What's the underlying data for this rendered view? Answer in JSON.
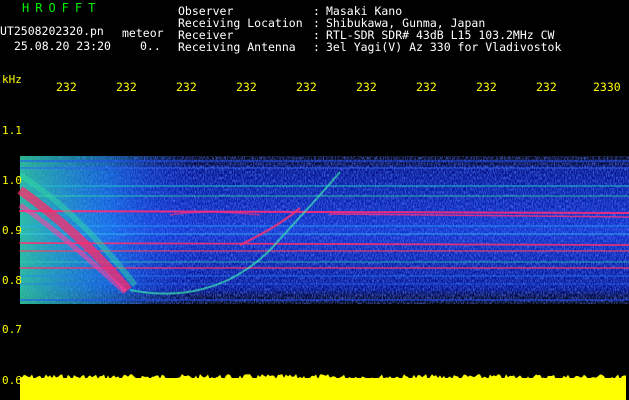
{
  "header": {
    "brand": "HROFFT",
    "filename": "UT2508202320.pn",
    "meteor_label": "meteor",
    "timestamp": "25.08.20 23:20",
    "count": "0.."
  },
  "station": [
    {
      "label": "Observer",
      "value": "Masaki Kano"
    },
    {
      "label": "Receiving Location",
      "value": "Shibukawa, Gunma, Japan"
    },
    {
      "label": "Receiver",
      "value": "RTL-SDR SDR# 43dB L15 103.2MHz CW"
    },
    {
      "label": "Receiving Antenna",
      "value": "3el Yagi(V) Az 330 for Vladivostok"
    }
  ],
  "axis": {
    "y_unit": "kHz",
    "y_ticks": [
      "1.1",
      "1.0",
      "0.9",
      "0.8",
      "0.7",
      "0.6"
    ],
    "x_ticks": [
      "232",
      "232",
      "232",
      "232",
      "232",
      "232",
      "232",
      "232",
      "232",
      "2330"
    ]
  },
  "colors": {
    "text_primary": "#00ee00",
    "text_secondary": "#ffffff",
    "axis": "#ffff00",
    "background": "#000000",
    "noise_bar": "#ffff00",
    "spectro_low": "#1020ff",
    "spectro_mid": "#20e0a0",
    "spectro_high": "#ff2060"
  }
}
